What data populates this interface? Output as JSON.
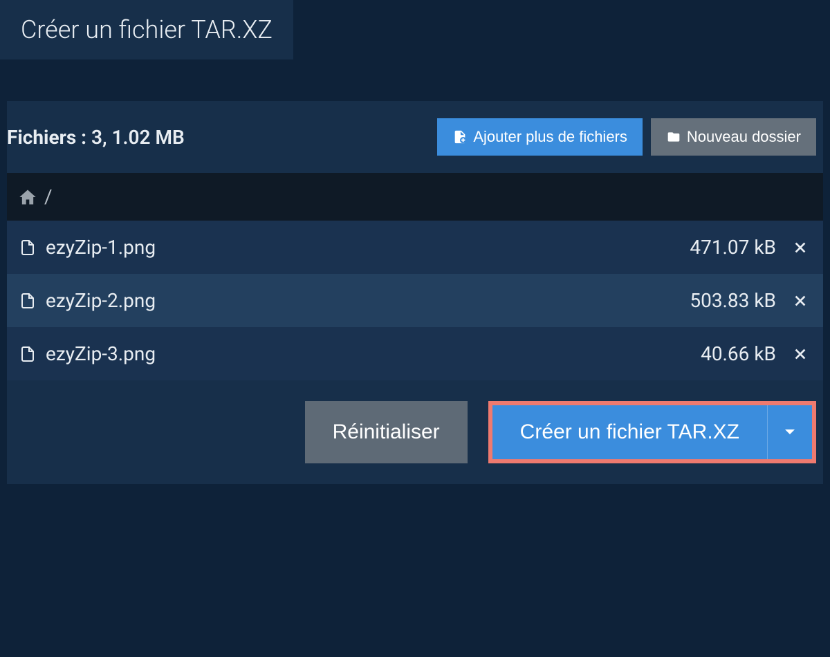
{
  "title": "Créer un fichier TAR.XZ",
  "files_label": "Fichiers :",
  "files_summary": "3, 1.02 MB",
  "buttons": {
    "add_more": "Ajouter plus de fichiers",
    "new_folder": "Nouveau dossier",
    "reset": "Réinitialiser",
    "create": "Créer un fichier TAR.XZ"
  },
  "breadcrumb": "/",
  "files": [
    {
      "name": "ezyZip-1.png",
      "size": "471.07 kB"
    },
    {
      "name": "ezyZip-2.png",
      "size": "503.83 kB"
    },
    {
      "name": "ezyZip-3.png",
      "size": "40.66 kB"
    }
  ]
}
